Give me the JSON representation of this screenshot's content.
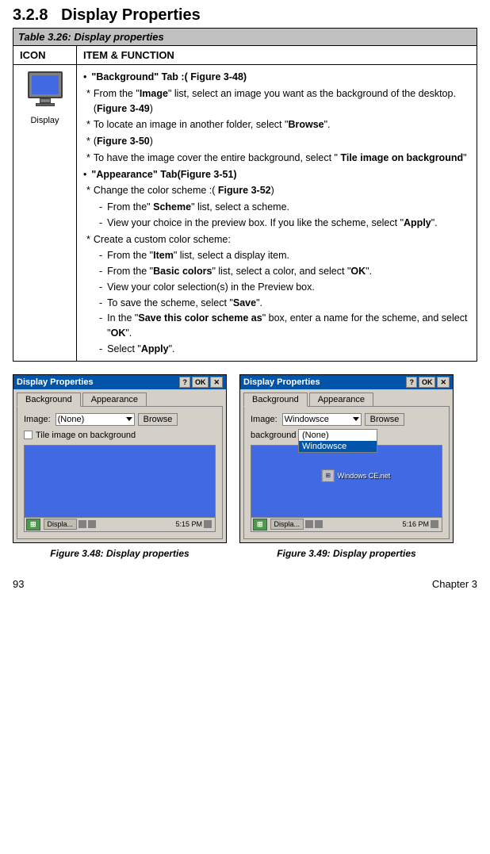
{
  "header": {
    "section": "3.2.8",
    "title": "Display Properties"
  },
  "table": {
    "title": "Table 3.26: Display properties",
    "columns": [
      "ICON",
      "ITEM & FUNCTION"
    ],
    "icon_label": "Display",
    "sections": [
      {
        "type": "bullet_header",
        "text": "\"Background\" Tab :( Figure 3-48)"
      },
      {
        "type": "star",
        "text": "From the \"Image\" list, select an image you want as the background of the desktop.(Figure 3-49)"
      },
      {
        "type": "star",
        "text": "To locate an image in another folder, select \"Browse\"."
      },
      {
        "type": "star",
        "text": "(Figure 3-50)"
      },
      {
        "type": "star",
        "text": "To have the image cover the entire background, select \" Tile image on background\""
      },
      {
        "type": "bullet_header",
        "text": "\"Appearance\" Tab(Figure 3-51)"
      },
      {
        "type": "star",
        "text": "Change the color scheme :( Figure 3-52)"
      },
      {
        "type": "dash",
        "text": "From the\" Scheme\" list, select a scheme."
      },
      {
        "type": "dash",
        "text": "View your choice in the preview box. If you like the scheme, select \"Apply\"."
      },
      {
        "type": "star",
        "text": "Create a custom color scheme:"
      },
      {
        "type": "dash",
        "text": "From the \"Item\" list, select a display item."
      },
      {
        "type": "dash",
        "text": "From the \"Basic colors\" list, select a color, and select \"OK\"."
      },
      {
        "type": "dash",
        "text": "View your color selection(s) in the Preview box."
      },
      {
        "type": "dash",
        "text": "To save the scheme, select \"Save\"."
      },
      {
        "type": "dash",
        "text": "In the \"Save this color scheme as\" box, enter a name for the scheme, and select \"OK\"."
      },
      {
        "type": "dash",
        "text": "Select \"Apply\"."
      }
    ]
  },
  "figures": {
    "fig48": {
      "title": "Display Properties",
      "tab_background": "Background",
      "tab_appearance": "Appearance",
      "label_image": "Image:",
      "dropdown_value": "(None)",
      "browse_label": "Browse",
      "checkbox_label": "Tile image on background",
      "time": "5:15 PM",
      "taskbar_item": "Displa...",
      "caption": "Figure 3.48: Display properties"
    },
    "fig49": {
      "title": "Display Properties",
      "tab_background": "Background",
      "tab_appearance": "Appearance",
      "label_image": "Image:",
      "dropdown_value": "Windowsce",
      "browse_label": "Browse",
      "checkbox_label": "background",
      "dropdown_items": [
        "(None)",
        "Windowsce"
      ],
      "selected_item": "Windowsce",
      "ce_text": "Windows CE.net",
      "time": "5:16 PM",
      "taskbar_item": "Displa...",
      "caption": "Figure 3.49: Display properties"
    }
  },
  "footer": {
    "page_number": "93",
    "chapter": "Chapter 3"
  }
}
